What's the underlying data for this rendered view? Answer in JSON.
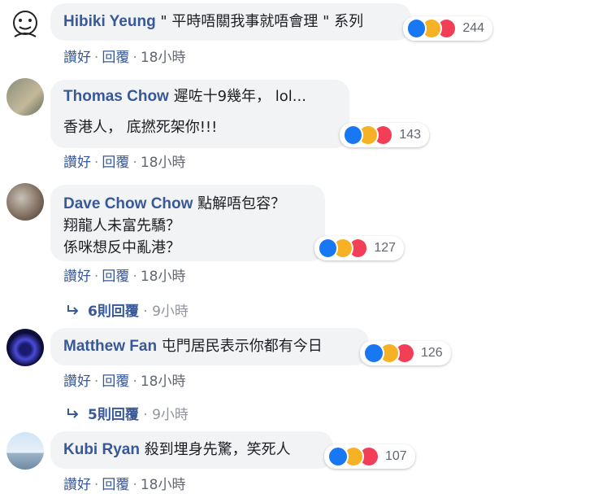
{
  "comments": [
    {
      "author": "Hibiki Yeung",
      "lines": [
        "\" 平時唔關我事就唔會理 \" 系列"
      ],
      "reaction_count": "244",
      "actions": {
        "like": "讚好",
        "reply": "回覆",
        "time": "18小時"
      }
    },
    {
      "author": "Thomas Chow",
      "lines": [
        "遲咗十9幾年， lol...",
        "香港人， 底撚死架你!!!"
      ],
      "reaction_count": "143",
      "actions": {
        "like": "讚好",
        "reply": "回覆",
        "time": "18小時"
      }
    },
    {
      "author": "Dave Chow Chow",
      "lines": [
        "點解唔包容？",
        "翔龍人未富先驕？",
        "係咪想反中亂港？"
      ],
      "reaction_count": "127",
      "actions": {
        "like": "讚好",
        "reply": "回覆",
        "time": "18小時"
      },
      "replies": {
        "label": "6則回覆",
        "time": "9小時"
      }
    },
    {
      "author": "Matthew Fan",
      "lines": [
        "屯門居民表示你都有今日"
      ],
      "reaction_count": "126",
      "actions": {
        "like": "讚好",
        "reply": "回覆",
        "time": "18小時"
      },
      "replies": {
        "label": "5則回覆",
        "time": "9小時"
      }
    },
    {
      "author": "Kubi Ryan",
      "lines": [
        "殺到埋身先驚，笑死人"
      ],
      "reaction_count": "107",
      "actions": {
        "like": "讚好",
        "reply": "回覆",
        "time": "18小時"
      }
    }
  ],
  "icons": {
    "like": "thumbs-up-icon",
    "haha": "laughing-face-icon",
    "love": "heart-icon",
    "reply_arrow": "reply-arrow-icon"
  },
  "colors": {
    "author": "#385898",
    "bubble": "#f2f3f5",
    "meta": "#606770",
    "like": "#1877f2",
    "haha": "#f7b125",
    "love": "#f33e58"
  }
}
